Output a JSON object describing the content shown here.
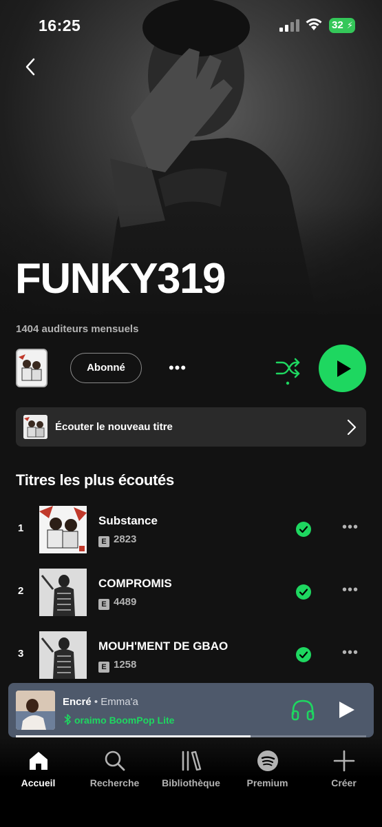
{
  "status": {
    "time": "16:25",
    "battery": "32"
  },
  "artist": {
    "name": "FUNKY319",
    "listeners": "1404 auditeurs mensuels"
  },
  "actions": {
    "follow_label": "Abonné",
    "more_label": "•••"
  },
  "new_release": {
    "label": "Écouter le nouveau titre"
  },
  "popular": {
    "heading": "Titres les plus écoutés",
    "tracks": [
      {
        "rank": "1",
        "title": "Substance",
        "explicit": "E",
        "plays": "2823"
      },
      {
        "rank": "2",
        "title": "COMPROMIS",
        "explicit": "E",
        "plays": "4489"
      },
      {
        "rank": "3",
        "title": "MOUH'MENT DE GBAO",
        "explicit": "E",
        "plays": "1258"
      }
    ]
  },
  "now_playing": {
    "title": "Encré",
    "artist": "Emma'a",
    "separator": " • ",
    "device": "oraimo BoomPop Lite",
    "progress": 0.67
  },
  "nav": {
    "items": [
      {
        "label": "Accueil",
        "icon": "home-icon",
        "active": true
      },
      {
        "label": "Recherche",
        "icon": "search-icon",
        "active": false
      },
      {
        "label": "Bibliothèque",
        "icon": "library-icon",
        "active": false
      },
      {
        "label": "Premium",
        "icon": "spotify-icon",
        "active": false
      },
      {
        "label": "Créer",
        "icon": "plus-icon",
        "active": false
      }
    ]
  },
  "colors": {
    "accent": "#1ed760",
    "background": "#121212",
    "mini_player": "#4e596b"
  }
}
